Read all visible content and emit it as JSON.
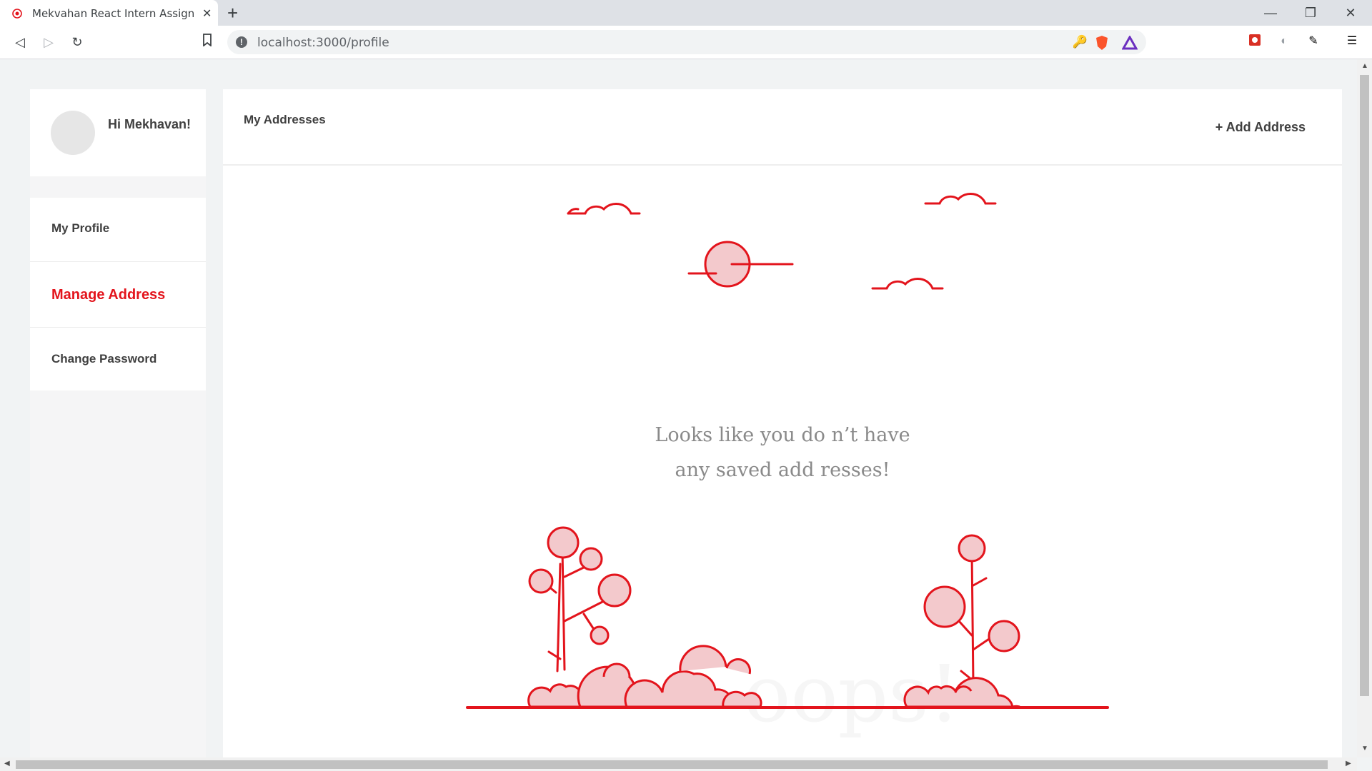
{
  "browser": {
    "tab_title": "Mekvahan React Intern Assignment",
    "new_tab_symbol": "+",
    "close_symbol": "✕",
    "url": "localhost:3000/profile"
  },
  "sidebar": {
    "greeting": "Hi Mekhavan!",
    "items": [
      {
        "label": "My Profile",
        "active": false
      },
      {
        "label": "Manage Address",
        "active": true
      },
      {
        "label": "Change Password",
        "active": false
      }
    ]
  },
  "main": {
    "title": "My Addresses",
    "add_button": "+ Add Address",
    "empty_line1": "Looks like you do n’t have",
    "empty_line2": "any saved add resses!",
    "watermark": "oops!"
  },
  "colors": {
    "accent": "#e3141c",
    "illustration_fill": "#f3c9cc",
    "text_dark": "#3f3f3f",
    "text_muted": "#8a8a8a"
  }
}
